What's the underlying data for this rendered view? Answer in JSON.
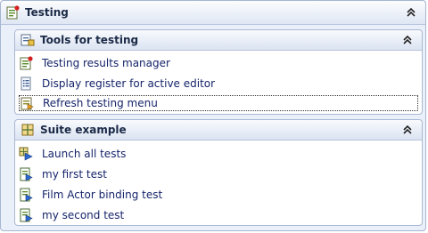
{
  "panel": {
    "title": "Testing",
    "collapse_icon": "double-chevron-up-icon"
  },
  "sections": [
    {
      "title": "Tools for testing",
      "icon": "tools-icon",
      "items": [
        {
          "label": "Testing results manager",
          "icon": "test-results-icon"
        },
        {
          "label": "Display register for active editor",
          "icon": "register-list-icon"
        },
        {
          "label": "Refresh testing menu",
          "icon": "refresh-menu-icon",
          "focused": true
        }
      ]
    },
    {
      "title": "Suite example",
      "icon": "suite-icon",
      "items": [
        {
          "label": "Launch all tests",
          "icon": "launch-all-icon"
        },
        {
          "label": "my first test",
          "icon": "test-run-icon"
        },
        {
          "label": "Film Actor binding test",
          "icon": "test-run-icon"
        },
        {
          "label": "my second test",
          "icon": "test-run-icon"
        }
      ]
    }
  ]
}
